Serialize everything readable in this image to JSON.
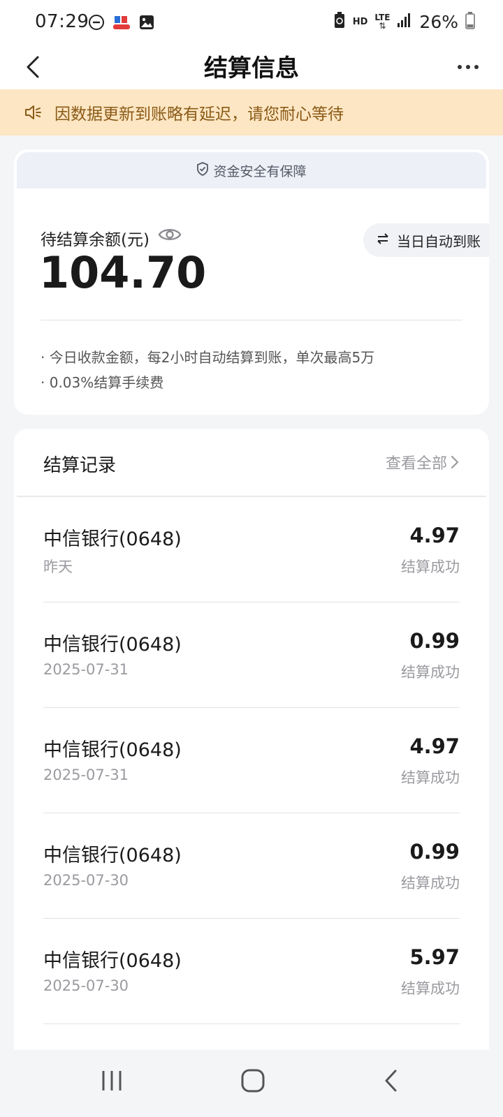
{
  "status_bar": {
    "time": "07:29",
    "network": "LTE",
    "hd": "HD",
    "battery_percent": "26%"
  },
  "header": {
    "title": "结算信息"
  },
  "notice": {
    "text": "因数据更新到账略有延迟，请您耐心等待"
  },
  "balance_card": {
    "safety_text": "资金安全有保障",
    "label": "待结算余额(元)",
    "value": "104.70",
    "auto_button_label": "当日自动到账",
    "rules": [
      "· 今日收款金额，每2小时自动结算到账，单次最高5万",
      "· 0.03%结算手续费"
    ]
  },
  "records": {
    "title": "结算记录",
    "view_all_label": "查看全部",
    "items": [
      {
        "bank": "中信银行(0648)",
        "date": "昨天",
        "amount": "4.97",
        "status": "结算成功"
      },
      {
        "bank": "中信银行(0648)",
        "date": "2025-07-31",
        "amount": "0.99",
        "status": "结算成功"
      },
      {
        "bank": "中信银行(0648)",
        "date": "2025-07-31",
        "amount": "4.97",
        "status": "结算成功"
      },
      {
        "bank": "中信银行(0648)",
        "date": "2025-07-30",
        "amount": "0.99",
        "status": "结算成功"
      },
      {
        "bank": "中信银行(0648)",
        "date": "2025-07-30",
        "amount": "5.97",
        "status": "结算成功"
      }
    ]
  },
  "colors": {
    "notice_bg": "#fde6c3",
    "notice_text": "#8a5a17",
    "page_bg": "#f4f5f7",
    "card_bg": "#ffffff",
    "muted_text": "#9a9aa0"
  },
  "icons": {
    "status_left": [
      "do-not-disturb-icon",
      "app-notification-icon",
      "gallery-icon"
    ],
    "status_right": [
      "battery-saver-icon",
      "hd-icon",
      "lte-icon",
      "signal-icon",
      "battery-icon"
    ],
    "header": [
      "back-arrow-icon",
      "more-icon"
    ],
    "notice": "speaker-icon",
    "safety": "shield-check-icon",
    "balance": "eye-icon",
    "auto_button": "swap-arrows-icon",
    "view_all": "chevron-right-icon",
    "nav": [
      "recent-apps-icon",
      "home-icon",
      "back-icon"
    ]
  }
}
